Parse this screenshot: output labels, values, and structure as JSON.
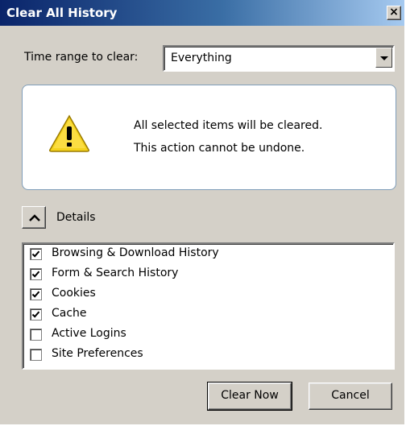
{
  "window": {
    "title": "Clear All History",
    "close_label": "×"
  },
  "time_range": {
    "label": "Time range to clear:",
    "selected": "Everything"
  },
  "warning": {
    "line1": "All selected items will be cleared.",
    "line2": "This action cannot be undone.",
    "icon": "warning-icon"
  },
  "details": {
    "label": "Details",
    "expanded": true
  },
  "items": [
    {
      "label": "Browsing & Download History",
      "checked": true
    },
    {
      "label": "Form & Search History",
      "checked": true
    },
    {
      "label": "Cookies",
      "checked": true
    },
    {
      "label": "Cache",
      "checked": true
    },
    {
      "label": "Active Logins",
      "checked": false
    },
    {
      "label": "Site Preferences",
      "checked": false
    }
  ],
  "buttons": {
    "clear_now": "Clear Now",
    "cancel": "Cancel"
  },
  "colors": {
    "titlebar_start": "#0a246a",
    "titlebar_end": "#a6caf0",
    "dialog_bg": "#d4d0c8",
    "warning_yellow": "#f5d31d"
  }
}
